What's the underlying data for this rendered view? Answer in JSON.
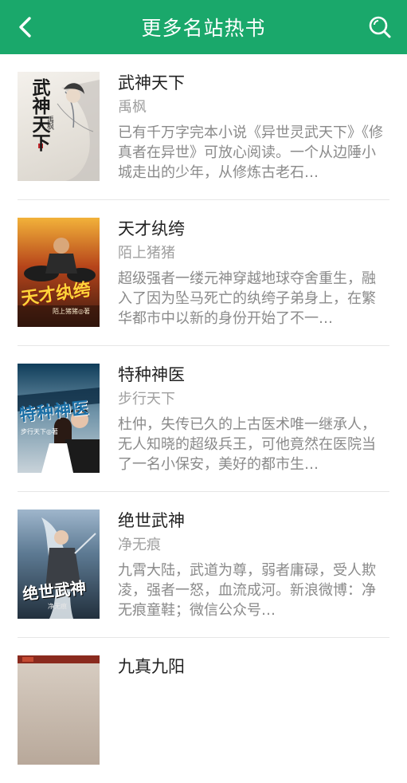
{
  "header": {
    "title": "更多名站热书",
    "back_icon": "chevron-left-icon",
    "search_icon": "search-icon",
    "bg_color": "#1aa86b"
  },
  "books": [
    {
      "title": "武神天下",
      "author": "禹枫",
      "description": "已有千万字完本小说《异世灵武天下》《修真者在异世》可放心阅读。一个从边陲小城走出的少年，从修炼古老石…",
      "cover_text": "武神天下",
      "cover_author": "禹枫"
    },
    {
      "title": "天才纨绔",
      "author": "陌上猪猪",
      "description": "超级强者一缕元神穿越地球夺舍重生，融入了因为坠马死亡的纨绔子弟身上，在繁华都市中以新的身份开始了不一…",
      "cover_text": "天才纨绔",
      "cover_author": "陌上猪猪◎著"
    },
    {
      "title": "特种神医",
      "author": "步行天下",
      "description": "杜仲，失传已久的上古医术唯一继承人，无人知晓的超级兵王，可他竟然在医院当了一名小保安，美好的都市生…",
      "cover_text": "特种神医",
      "cover_author": "步行天下◎著"
    },
    {
      "title": "绝世武神",
      "author": "净无痕",
      "description": "九霄大陆，武道为尊，弱者庸碌，受人欺凌，强者一怒，血流成河。新浪微博：净无痕童鞋；微信公众号…",
      "cover_text": "绝世武神",
      "cover_author": "净无痕"
    },
    {
      "title": "九真九阳",
      "author": "",
      "description": "",
      "cover_text": "",
      "cover_author": ""
    }
  ]
}
